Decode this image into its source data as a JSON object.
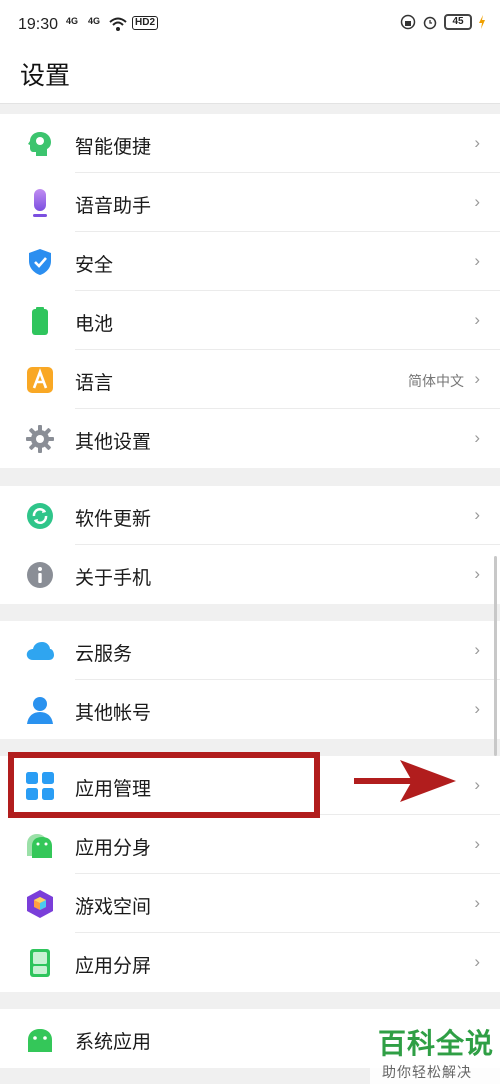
{
  "status": {
    "time": "19:30",
    "sig1": "4G",
    "sig2": "4G",
    "hd": "HD2",
    "battery": "45"
  },
  "header": {
    "title": "设置"
  },
  "sections": [
    {
      "items": [
        {
          "label": "智能便捷",
          "icon": "smart-head-icon"
        },
        {
          "label": "语音助手",
          "icon": "microphone-icon"
        },
        {
          "label": "安全",
          "icon": "shield-icon"
        },
        {
          "label": "电池",
          "icon": "battery-icon"
        },
        {
          "label": "语言",
          "icon": "language-icon",
          "value": "简体中文"
        },
        {
          "label": "其他设置",
          "icon": "gear-icon"
        }
      ]
    },
    {
      "items": [
        {
          "label": "软件更新",
          "icon": "update-icon"
        },
        {
          "label": "关于手机",
          "icon": "info-icon"
        }
      ]
    },
    {
      "items": [
        {
          "label": "云服务",
          "icon": "cloud-icon"
        },
        {
          "label": "其他帐号",
          "icon": "person-icon"
        }
      ]
    },
    {
      "items": [
        {
          "label": "应用管理",
          "icon": "app-grid-icon"
        },
        {
          "label": "应用分身",
          "icon": "android-clone-icon"
        },
        {
          "label": "游戏空间",
          "icon": "game-cube-icon"
        },
        {
          "label": "应用分屏",
          "icon": "split-screen-icon"
        }
      ]
    },
    {
      "items": [
        {
          "label": "系统应用",
          "icon": "android-icon"
        }
      ]
    }
  ],
  "chevron": "›",
  "watermark": {
    "title": "百科全说",
    "subtitle": "助你轻松解决"
  },
  "colors": {
    "highlight": "#b11d1d",
    "watermark": "#2f9f45"
  }
}
